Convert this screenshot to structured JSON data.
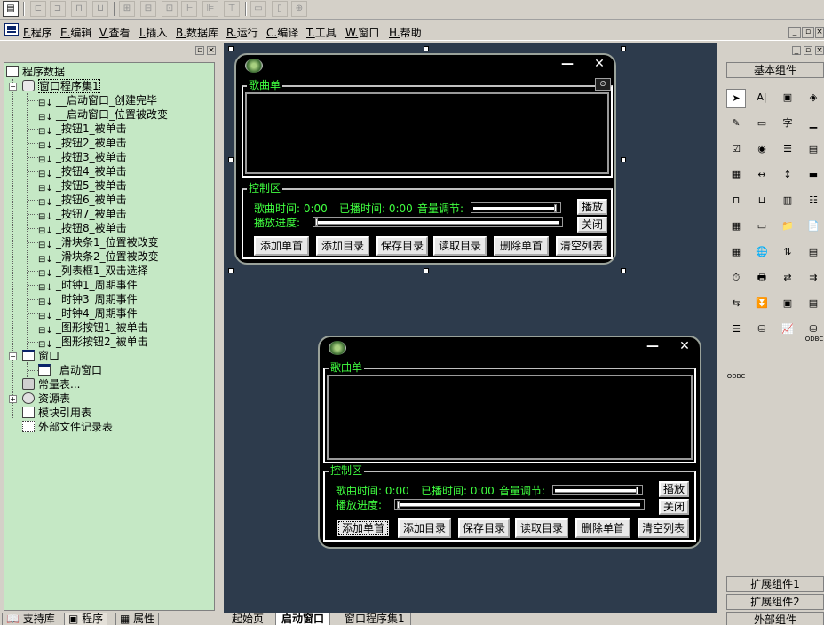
{
  "menu": {
    "file": {
      "key": "F.",
      "label": "程序"
    },
    "edit": {
      "key": "E.",
      "label": "编辑"
    },
    "view": {
      "key": "V.",
      "label": "查看"
    },
    "insert": {
      "key": "I.",
      "label": "插入"
    },
    "database": {
      "key": "B.",
      "label": "数据库"
    },
    "run": {
      "key": "R.",
      "label": "运行"
    },
    "compile": {
      "key": "C.",
      "label": "编译"
    },
    "tools": {
      "key": "T.",
      "label": "工具"
    },
    "window": {
      "key": "W.",
      "label": "窗口"
    },
    "help": {
      "key": "H.",
      "label": "帮助"
    }
  },
  "tree": {
    "root": "程序数据",
    "window_program_set": "窗口程序集1",
    "events": [
      "__启动窗口_创建完毕",
      "__启动窗口_位置被改变",
      "_按钮1_被单击",
      "_按钮2_被单击",
      "_按钮3_被单击",
      "_按钮4_被单击",
      "_按钮5_被单击",
      "_按钮6_被单击",
      "_按钮7_被单击",
      "_按钮8_被单击",
      "_滑块条1_位置被改变",
      "_滑块条2_位置被改变",
      "_列表框1_双击选择",
      "_时钟1_周期事件",
      "_时钟3_周期事件",
      "_时钟4_周期事件",
      "_图形按钮1_被单击",
      "_图形按钮2_被单击"
    ],
    "window_folder": "窗口",
    "start_window": "_启动窗口",
    "constants": "常量表...",
    "resources": "资源表",
    "module_refs": "模块引用表",
    "external_files": "外部文件记录表"
  },
  "bottom_tabs": [
    "支持库",
    "程序",
    "属性"
  ],
  "doc_tabs": [
    "起始页",
    "启动窗口",
    "窗口程序集1"
  ],
  "designer": {
    "playlist_label": "歌曲单",
    "control_label": "控制区",
    "song_time": "歌曲时间: 0:00",
    "played_time": "已播时间: 0:00",
    "volume": "音量调节:",
    "progress": "播放进度:",
    "play": "播放",
    "close": "关闭",
    "buttons": [
      "添加单首",
      "添加目录",
      "保存目录",
      "读取目录",
      "删除单首",
      "清空列表"
    ],
    "minimize_symbol": "—",
    "close_symbol": "✕",
    "volume_level": 0.97,
    "progress_level": 0.0
  },
  "components": {
    "basic": "基本组件",
    "extended1": "扩展组件1",
    "extended2": "扩展组件2",
    "external": "外部组件",
    "odbc": "ODBC",
    "label_ai": "A|",
    "label_char": "字"
  },
  "colors": {
    "tree_bg": "#c5e8c5",
    "workspace_bg": "#2d3b4c",
    "green_text": "#40ff40"
  }
}
